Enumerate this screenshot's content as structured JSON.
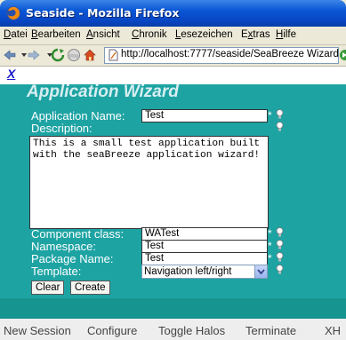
{
  "window": {
    "title": "Seaside - Mozilla Firefox"
  },
  "menu": {
    "items": [
      {
        "prefix": "",
        "underlined": "D",
        "rest": "atei"
      },
      {
        "prefix": "",
        "underlined": "B",
        "rest": "earbeiten"
      },
      {
        "prefix": "",
        "underlined": "A",
        "rest": "nsicht"
      },
      {
        "prefix": "",
        "underlined": "C",
        "rest": "hronik"
      },
      {
        "prefix": "",
        "underlined": "L",
        "rest": "esezeichen"
      },
      {
        "prefix": "E",
        "underlined": "x",
        "rest": "tras"
      },
      {
        "prefix": "",
        "underlined": "H",
        "rest": "ilfe"
      }
    ]
  },
  "nav": {
    "url": "http://localhost:7777/seaside/SeaBreeze Wizard",
    "icons": [
      "back-arrow-icon",
      "forward-arrow-icon",
      "reload-icon",
      "stop-icon",
      "home-icon",
      "page-icon",
      "go-icon"
    ]
  },
  "wizard": {
    "close_link": "X",
    "title": "Application Wizard",
    "app_name_label": "Application Name:",
    "app_name_value": "Test",
    "description_label": "Description:",
    "description_value": "This is a small test application built\nwith the seaBreeze application wizard!",
    "component_class_label": "Component class:",
    "component_class_value": "WATest",
    "namespace_label": "Namespace:",
    "namespace_value": "Test",
    "package_label": "Package Name:",
    "package_value": "Test",
    "template_label": "Template:",
    "template_value": "Navigation left/right",
    "required_marker": "*",
    "clear_label": "Clear",
    "create_label": "Create"
  },
  "bottom_links": [
    "New Session",
    "Configure",
    "Toggle Halos",
    "Terminate",
    "XH"
  ],
  "colors": {
    "content_bg": "#1ea3a3",
    "title_bar": "#0a56d5",
    "link": "#1a1acc"
  }
}
